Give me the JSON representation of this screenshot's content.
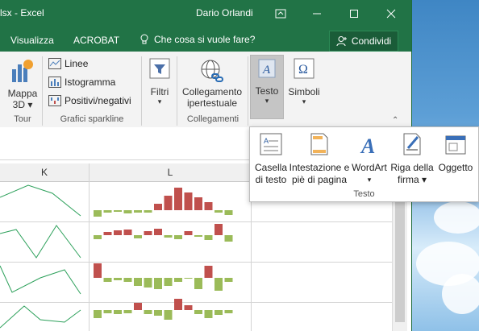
{
  "window": {
    "title": "lsx - Excel",
    "user": "Dario Orlandi"
  },
  "tabs": [
    "Visualizza",
    "ACROBAT"
  ],
  "tellme": "Che cosa si vuole fare?",
  "share": "Condividi",
  "ribbon": {
    "tour": {
      "button_line1": "Mappa",
      "button_line2": "3D",
      "group": "Tour"
    },
    "sparklines": {
      "items": [
        "Linee",
        "Istogramma",
        "Positivi/negativi"
      ],
      "group": "Grafici sparkline"
    },
    "filters": {
      "button": "Filtri"
    },
    "links": {
      "button_line1": "Collegamento",
      "button_line2": "ipertestuale",
      "group": "Collegamenti"
    },
    "text": {
      "button": "Testo"
    },
    "symbols": {
      "button": "Simboli"
    }
  },
  "columns": [
    "K",
    "L"
  ],
  "popup": {
    "items": [
      {
        "line1": "Casella",
        "line2": "di testo"
      },
      {
        "line1": "Intestazione e",
        "line2": "piè di pagina"
      },
      {
        "line1": "WordArt",
        "line2": ""
      },
      {
        "line1": "Riga della",
        "line2": "firma"
      },
      {
        "line1": "Oggetto",
        "line2": ""
      }
    ],
    "group": "Testo"
  },
  "colors": {
    "excel_green": "#217346",
    "spark_line": "#2ca05a",
    "bar_neg": "#c0504d",
    "bar_pos": "#9bbb59"
  }
}
